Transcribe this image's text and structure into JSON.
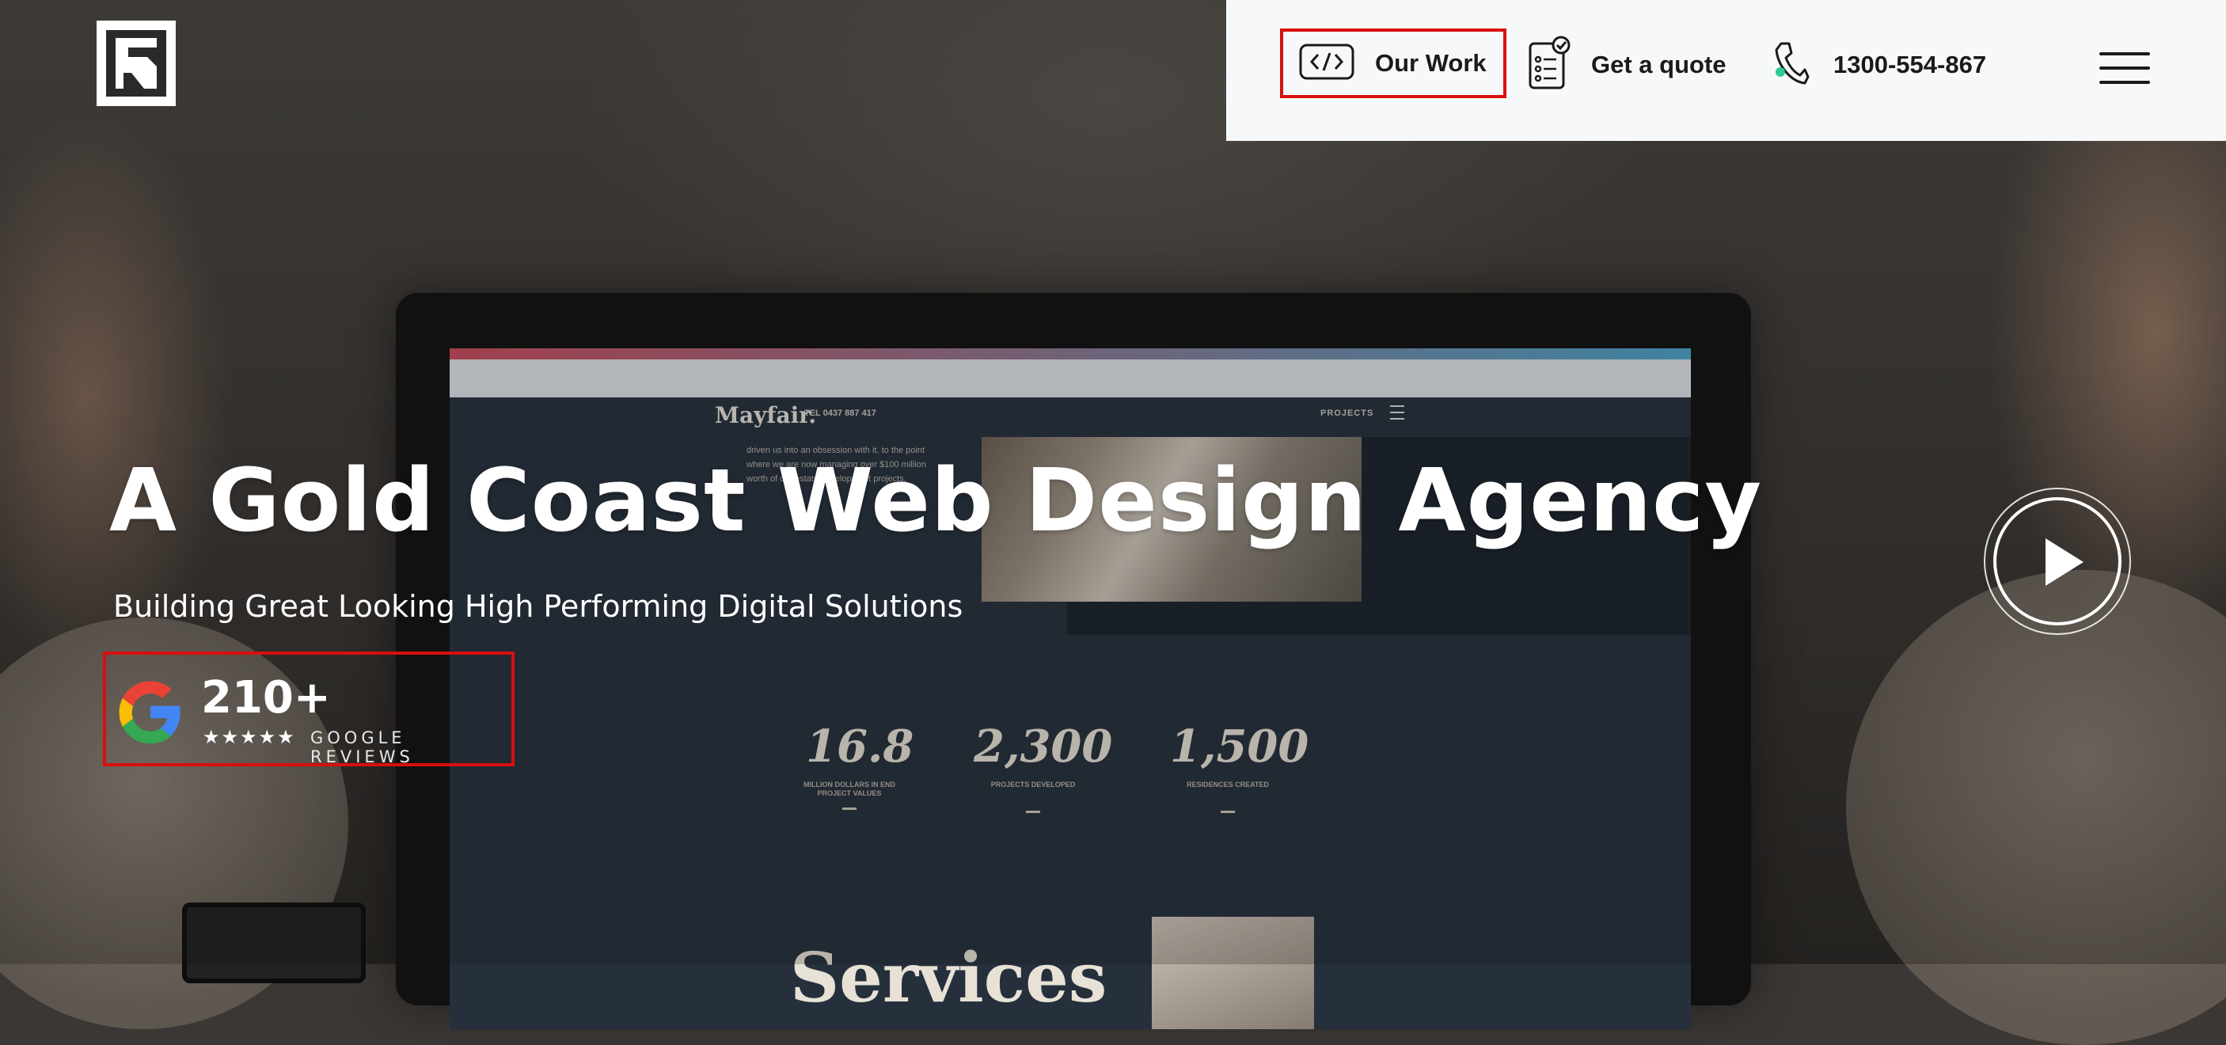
{
  "header": {
    "nav": {
      "our_work": "Our Work",
      "get_quote": "Get a quote",
      "phone": "1300-554-867"
    }
  },
  "hero": {
    "title": "A Gold Coast Web Design Agency",
    "subtitle": "Building Great Looking High Performing Digital Solutions",
    "reviews": {
      "count": "210+",
      "stars": "★★★★★",
      "rating": 5,
      "label": "GOOGLE REVIEWS"
    }
  },
  "background_screen": {
    "brand": "Mayfair.",
    "tel": "TEL 0437 887 417",
    "projects": "PROJECTS",
    "intro": "driven us into an obsession with it, to the point where we are now managing over $100 million worth of our estate development projects.",
    "stats": [
      {
        "value": "16.8",
        "caption": "MILLION DOLLARS IN END PROJECT VALUES"
      },
      {
        "value": "2,300",
        "caption": "PROJECTS DEVELOPED"
      },
      {
        "value": "1,500",
        "caption": "RESIDENCES CREATED"
      }
    ],
    "services_heading": "Services"
  },
  "colors": {
    "highlight": "#d80f0f",
    "header_bg": "#f7f8fa",
    "phone_accent": "#2ecc8f"
  },
  "icons": {
    "logo": "brand-logo-icon",
    "code": "code-icon",
    "quote": "checklist-icon",
    "phone": "phone-icon",
    "menu": "hamburger-icon",
    "google": "google-g-icon",
    "play": "play-icon"
  }
}
